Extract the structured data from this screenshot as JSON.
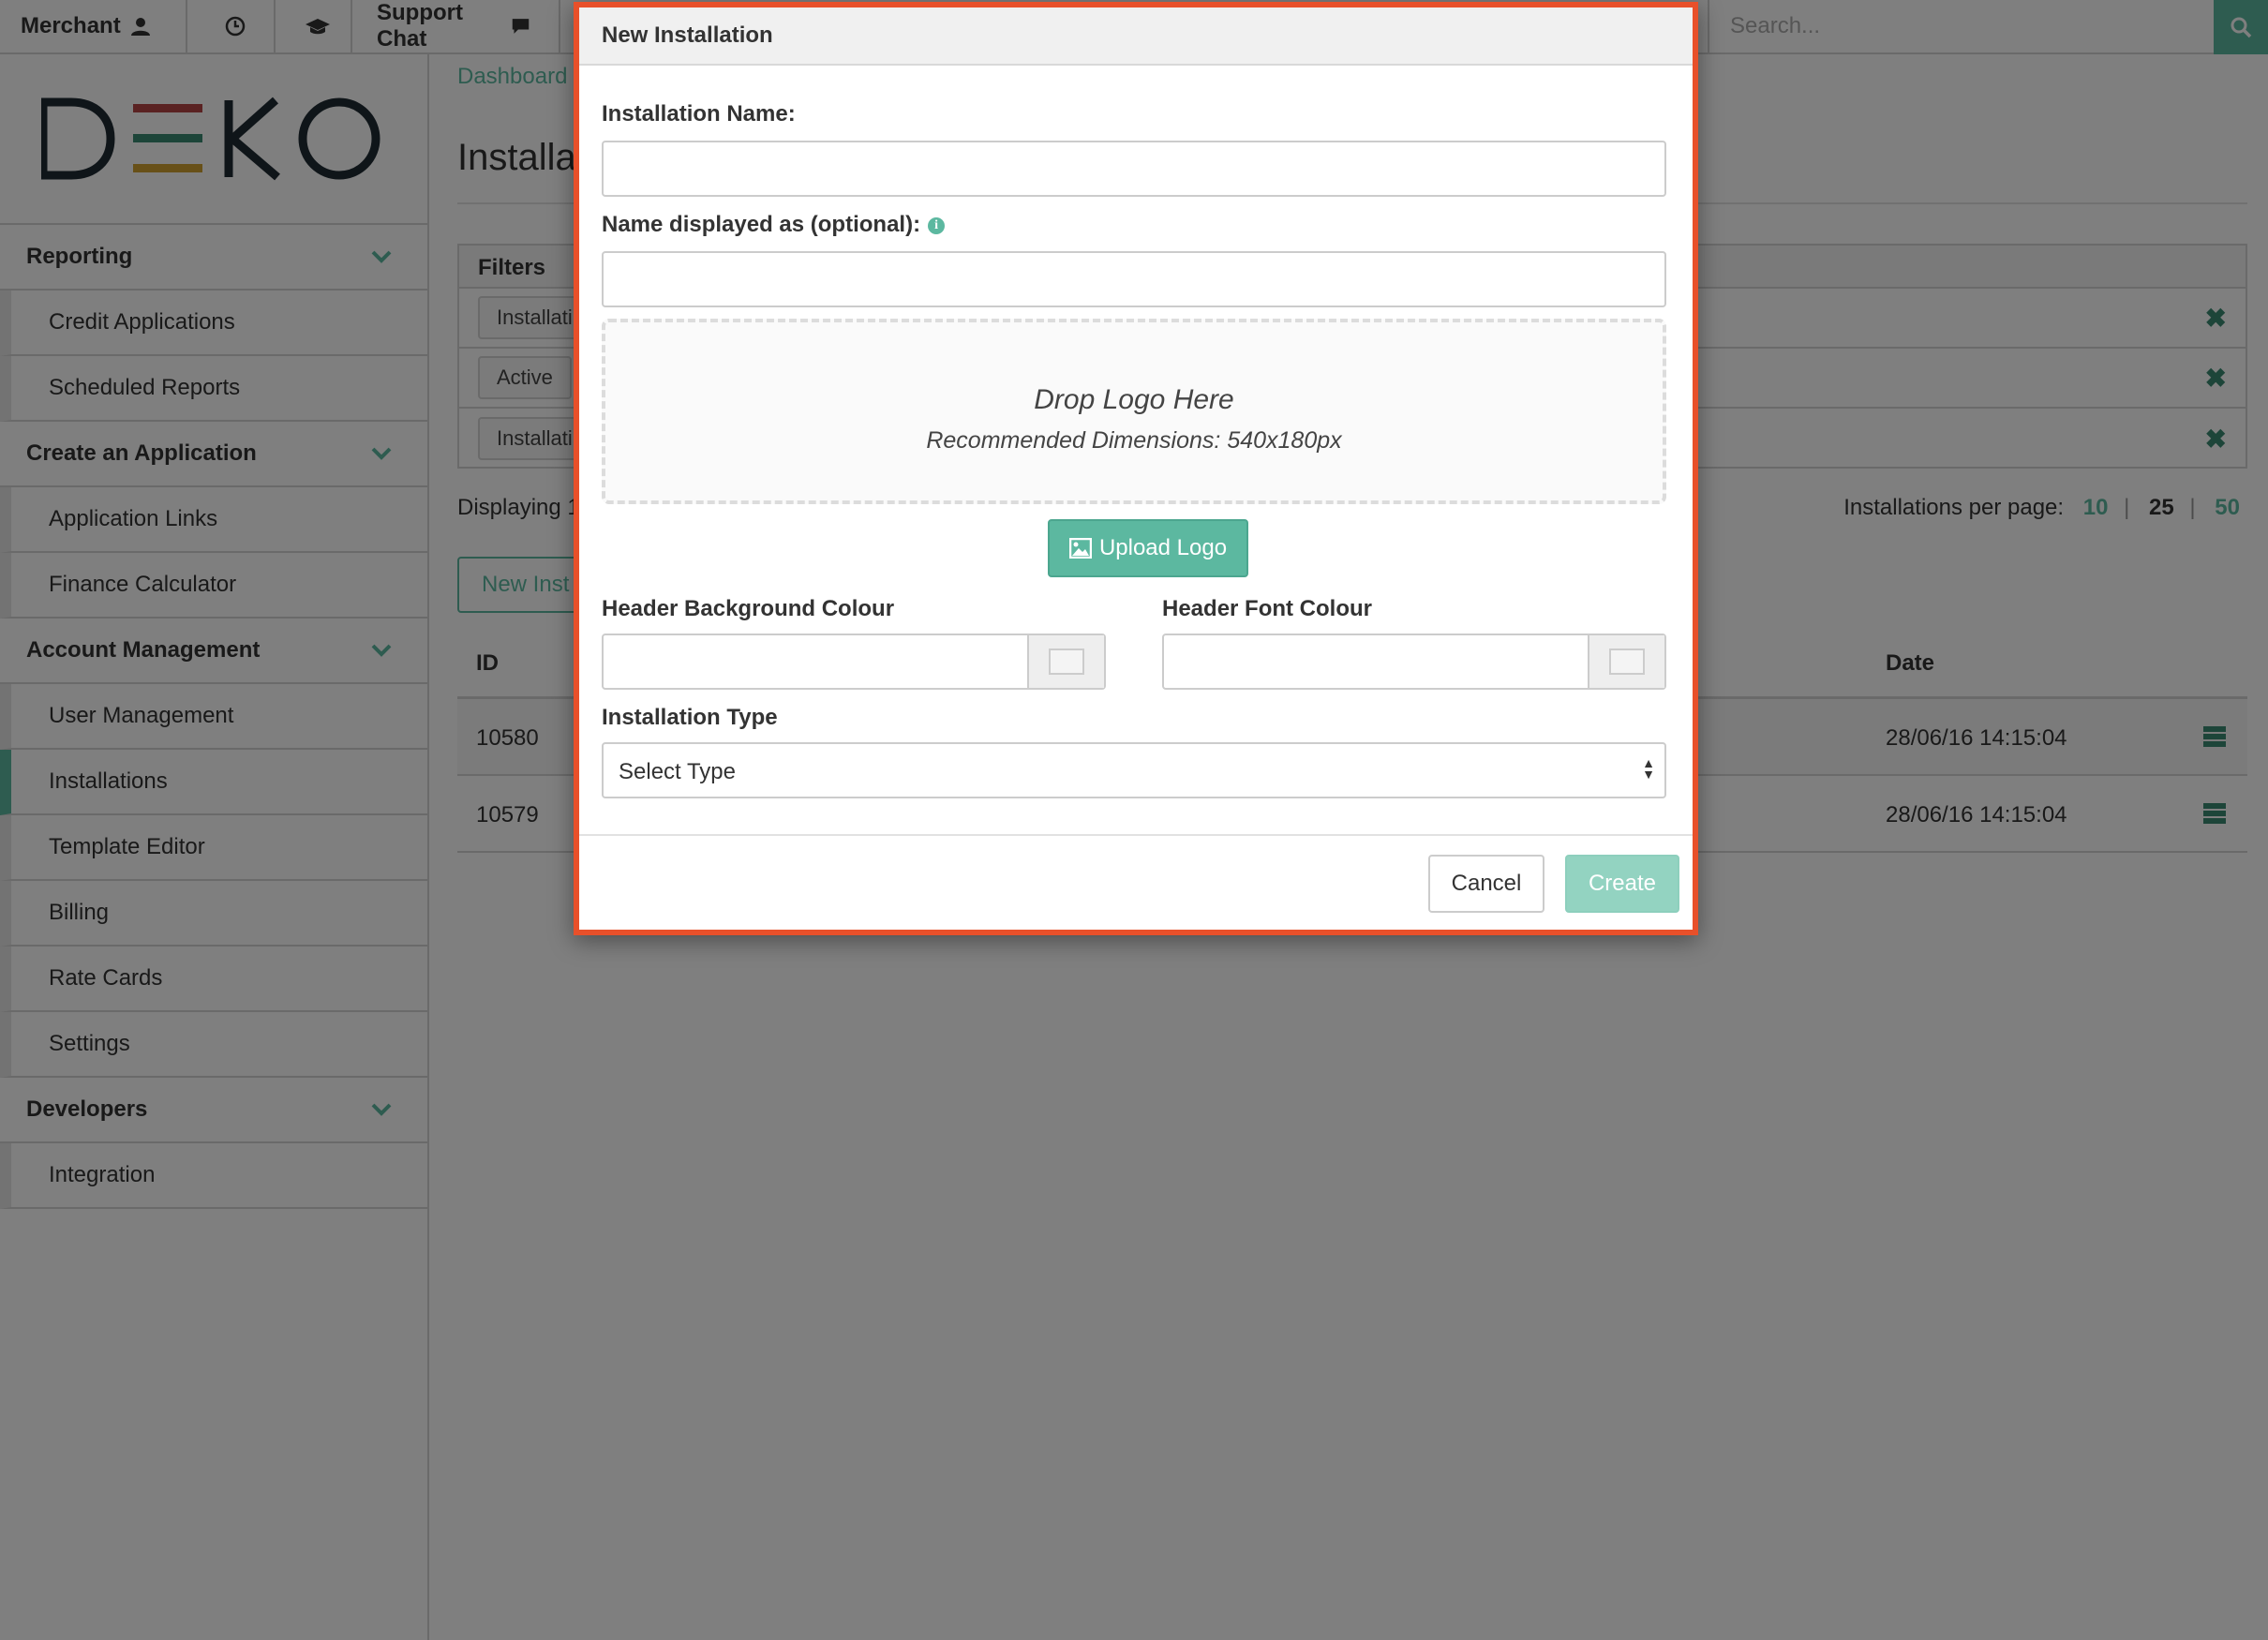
{
  "topbar": {
    "merchant_label": "Merchant",
    "support_label": "Support Chat",
    "search_placeholder": "Search..."
  },
  "sidebar": {
    "logo_text": "DEKO",
    "sections": [
      {
        "label": "Reporting",
        "items": [
          "Credit Applications",
          "Scheduled Reports"
        ]
      },
      {
        "label": "Create an Application",
        "items": [
          "Application Links",
          "Finance Calculator"
        ]
      },
      {
        "label": "Account Management",
        "items": [
          "User Management",
          "Installations",
          "Template Editor",
          "Billing",
          "Rate Cards",
          "Settings"
        ]
      },
      {
        "label": "Developers",
        "items": [
          "Integration"
        ]
      }
    ],
    "active_item": "Installations"
  },
  "main": {
    "breadcrumb": "Dashboard /",
    "title": "Installat",
    "filters": {
      "heading": "Filters",
      "pills": [
        "Installati",
        "Active",
        "Installati"
      ]
    },
    "displaying": "Displaying 1",
    "per_page_label": "Installations per page:",
    "per_page_options": [
      "10",
      "25",
      "50"
    ],
    "new_button": "New Inst",
    "table": {
      "headers": {
        "id": "ID",
        "date": "Date"
      },
      "rows": [
        {
          "id": "10580",
          "date": "28/06/16 14:15:04"
        },
        {
          "id": "10579",
          "date": "28/06/16 14:15:04"
        }
      ]
    }
  },
  "modal": {
    "title": "New Installation",
    "name_label": "Installation Name:",
    "display_label": "Name displayed as (optional):",
    "dropzone_title": "Drop Logo Here",
    "dropzone_sub": "Recommended Dimensions: 540x180px",
    "upload_label": "Upload Logo",
    "bg_colour_label": "Header Background Colour",
    "font_colour_label": "Header Font Colour",
    "type_label": "Installation Type",
    "type_selected": "Select Type",
    "cancel_label": "Cancel",
    "create_label": "Create"
  },
  "colors": {
    "accent": "#5cb8a0",
    "modal_border": "#e8502a",
    "overlay": "rgba(0,0,0,0.5)"
  }
}
